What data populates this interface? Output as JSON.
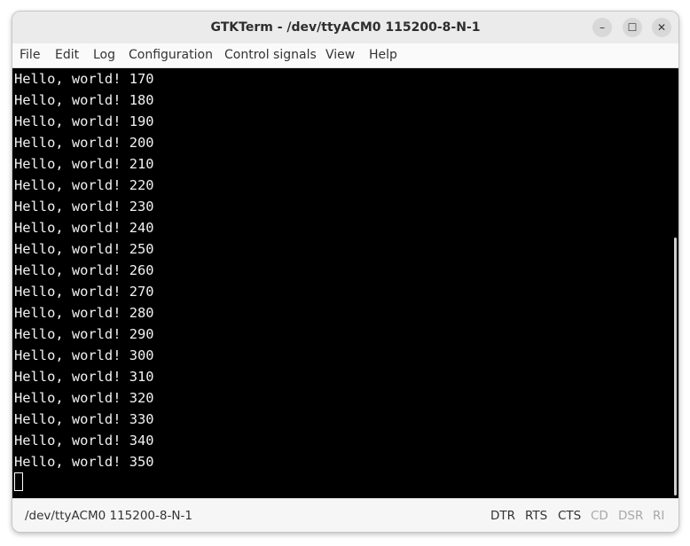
{
  "window": {
    "title": "GTKTerm - /dev/ttyACM0  115200-8-N-1",
    "controls": {
      "minimize": "–",
      "maximize": "☐",
      "close": "✕"
    }
  },
  "menu": {
    "items": [
      "File",
      "Edit",
      "Log",
      "Configuration",
      "Control signals",
      "View",
      "Help"
    ]
  },
  "terminal": {
    "lines": [
      "Hello, world! 170",
      "Hello, world! 180",
      "Hello, world! 190",
      "Hello, world! 200",
      "Hello, world! 210",
      "Hello, world! 220",
      "Hello, world! 230",
      "Hello, world! 240",
      "Hello, world! 250",
      "Hello, world! 260",
      "Hello, world! 270",
      "Hello, world! 280",
      "Hello, world! 290",
      "Hello, world! 300",
      "Hello, world! 310",
      "Hello, world! 320",
      "Hello, world! 330",
      "Hello, world! 340",
      "Hello, world! 350"
    ],
    "background": "#000000",
    "foreground": "#f2f2f2"
  },
  "status": {
    "port": "/dev/ttyACM0  115200-8-N-1",
    "signals": [
      {
        "label": "DTR",
        "active": true
      },
      {
        "label": "RTS",
        "active": true
      },
      {
        "label": "CTS",
        "active": true
      },
      {
        "label": "CD",
        "active": false
      },
      {
        "label": "DSR",
        "active": false
      },
      {
        "label": "RI",
        "active": false
      }
    ],
    "active_color": "#333333",
    "inactive_color": "#a8a8a8"
  }
}
